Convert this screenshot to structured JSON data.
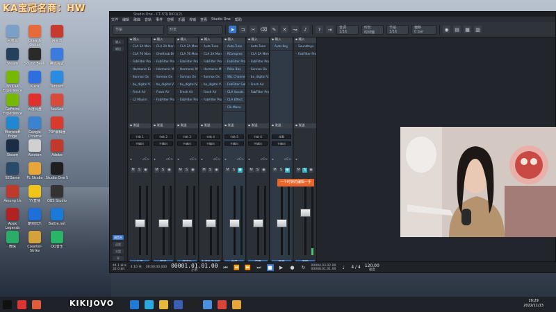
{
  "watermark": "KA宝冠名商：HW",
  "desktop_icons": [
    {
      "label": "回收站",
      "color": "#7aa0c8"
    },
    {
      "label": "Draw &amp; Guitar",
      "color": "#e86a3a"
    },
    {
      "label": "网易云",
      "color": "#c8392e"
    },
    {
      "label": "Steam",
      "color": "#24405c"
    },
    {
      "label": "Sound Bank",
      "color": "#2a2a2a"
    },
    {
      "label": "腾讯会议",
      "color": "#3b7be0"
    },
    {
      "label": "NVIDIA Experience",
      "color": "#76b900"
    },
    {
      "label": "Kuzu",
      "color": "#2d6fe0"
    },
    {
      "label": "Tencent",
      "color": "#2a8ce0"
    },
    {
      "label": "GeForce Experience",
      "color": "#76b900"
    },
    {
      "label": "百度网盘",
      "color": "#e0312e"
    },
    {
      "label": "SeaSee",
      "color": "#d84a3a"
    },
    {
      "label": "Microsoft Edge",
      "color": "#1f88d0"
    },
    {
      "label": "Google Chrome",
      "color": "#3b82d0"
    },
    {
      "label": "PDF编辑器",
      "color": "#d83b2e"
    },
    {
      "label": "Steam",
      "color": "#1a2d44"
    },
    {
      "label": "Ableton",
      "color": "#d0d0d0"
    },
    {
      "label": "Adobe",
      "color": "#c0392b"
    },
    {
      "label": "SEGame",
      "color": "#2a4a6a"
    },
    {
      "label": "FL Studio",
      "color": "#e8a53a"
    },
    {
      "label": "Studio One 5",
      "color": "#1f1f1f"
    },
    {
      "label": "Among Us",
      "color": "#c0392b"
    },
    {
      "label": "YY直播",
      "color": "#f0c419"
    },
    {
      "label": "OBS Studio",
      "color": "#333"
    },
    {
      "label": "Apex Legends",
      "color": "#b22222"
    },
    {
      "label": "酷狗音乐",
      "color": "#1e6fd9"
    },
    {
      "label": "Battle.net",
      "color": "#1a7ad8"
    },
    {
      "label": "微信",
      "color": "#2aae67"
    },
    {
      "label": "Counter-Strike",
      "color": "#d4a23a"
    },
    {
      "label": "QQ音乐",
      "color": "#2ab566"
    }
  ],
  "app": {
    "title": "Studio One - CT-STUDIO1(2)",
    "menu": [
      "文件",
      "编辑",
      "歌曲",
      "音轨",
      "事件",
      "音频",
      "乐器",
      "传输",
      "查看",
      "Studio One",
      "帮助"
    ],
    "toolbar": {
      "field1_top": "节拍",
      "field1_value": "1/16",
      "field2_top": "时长",
      "field2_value": "时间轴",
      "field3_top": "音调",
      "field3_value": "1/16",
      "field4_top": "偏移",
      "field4_value": "0 bar"
    },
    "left_buttons": [
      "输入",
      "输出",
      "调音台",
      "远程",
      "大型",
      "窄"
    ],
    "left_active": "调音台"
  },
  "mixer": {
    "tooltip": "一个时钟的编辑一手",
    "send_header": "发送",
    "strips": [
      {
        "header": "输入",
        "inserts": [
          "CLA 2A Mono",
          "CLA 76 Mono",
          "FabFilter Pro",
          "Harmonic Ex",
          "Sonnox Ox",
          "bx_digital V3",
          "Fresh Air",
          "L2 Maxim"
        ],
        "io_in": "分轨 1",
        "io_out": "主输出",
        "pan": "<C>",
        "name": "人声",
        "fader": 0.45,
        "meter": 0.0,
        "selected": false,
        "solo": false
      },
      {
        "header": "输入",
        "inserts": [
          "CLA 2A Mono",
          "OneKnob Br",
          "FabFilter Pro",
          "Harmonic M",
          "Sonnox Ox",
          "bx_digital V3",
          "Fresh Air",
          "FabFilter Pro"
        ],
        "io_in": "分轨 2",
        "io_out": "主输出",
        "pan": "<C>",
        "name": "和声",
        "fader": 0.45,
        "meter": 0.0,
        "selected": false,
        "solo": false
      },
      {
        "header": "输入",
        "inserts": [
          "CLA 2A Mono",
          "CLA 76 Mono",
          "FabFilter Pro",
          "Harmonic M",
          "Sonnox Ox",
          "bx_digital V3",
          "Fresh Air",
          "FabFilter Pro"
        ],
        "io_in": "分轨 3",
        "io_out": "主输出",
        "pan": "<C>",
        "name": "和声2",
        "fader": 0.45,
        "meter": 0.0,
        "selected": false,
        "solo": false
      },
      {
        "header": "输入",
        "inserts": [
          "Auto-Tune",
          "CLA 2A Mono",
          "FabFilter Pro",
          "Harmonic M",
          "Sonnox Ox",
          "bx_digital V3",
          "Fresh Air",
          "FabFilter Pro"
        ],
        "io_in": "分轨 4",
        "io_out": "主输出",
        "pan": "<C>",
        "name": "AUTO-TUNE",
        "fader": 0.45,
        "meter": 0.0,
        "selected": false,
        "solo": false
      },
      {
        "header": "输入",
        "inserts": [
          "Auto-Tune",
          "RCompres",
          "FabFilter Pro",
          "RVox Box",
          "SSL Channel",
          "FabFilter Gat",
          "CLA Vocals",
          "CLA Effect",
          "Clk Mono"
        ],
        "io_in": "分轨 5",
        "io_out": "主输出",
        "pan": "<C>",
        "name": "合成",
        "fader": 0.45,
        "meter": 0.0,
        "selected": true,
        "solo": false
      },
      {
        "header": "输入",
        "inserts": [
          "Auto-Tune",
          "CLA 2A Mono",
          "FabFilter Pro",
          "Sonnox Ox",
          "bx_digital V3",
          "Fresh Air",
          "FabFilter Pro"
        ],
        "io_in": "分轨 6",
        "io_out": "主输出",
        "pan": "<C>",
        "name": "说唱",
        "fader": 0.45,
        "meter": 0.0,
        "selected": false,
        "solo": false
      },
      {
        "header": "输入",
        "inserts": [
          "Auto-Key"
        ],
        "io_in": "伴奏",
        "io_out": "主输出",
        "pan": "<C>",
        "name": "伴奏",
        "fader": 0.45,
        "meter": 0.0,
        "selected": true,
        "solo": false
      },
      {
        "header": "输入",
        "inserts": [
          "Soundtoys",
          "FabFilter Pro"
        ],
        "io_in": "",
        "io_out": "",
        "pan": "",
        "name": "混响",
        "fader": 0.62,
        "meter": 0.1,
        "selected": false,
        "solo": true
      }
    ]
  },
  "transport": {
    "sample_rate": "44.1 kHz",
    "bit_depth": "32.0 bit",
    "record_time": "4:10 天",
    "time_display": "00:00:00.000",
    "position": "00001.01.01.00",
    "position_label": "小节",
    "loop_start": "00004.03.02.00",
    "loop_end": "00008.01.01.00",
    "signature": "4 / 4",
    "tempo": "120.00",
    "tempo_label": "速度"
  },
  "taskbar": {
    "streamer_name": "KIKIJOVO",
    "time": "19:29",
    "date": "2022/11/13"
  }
}
